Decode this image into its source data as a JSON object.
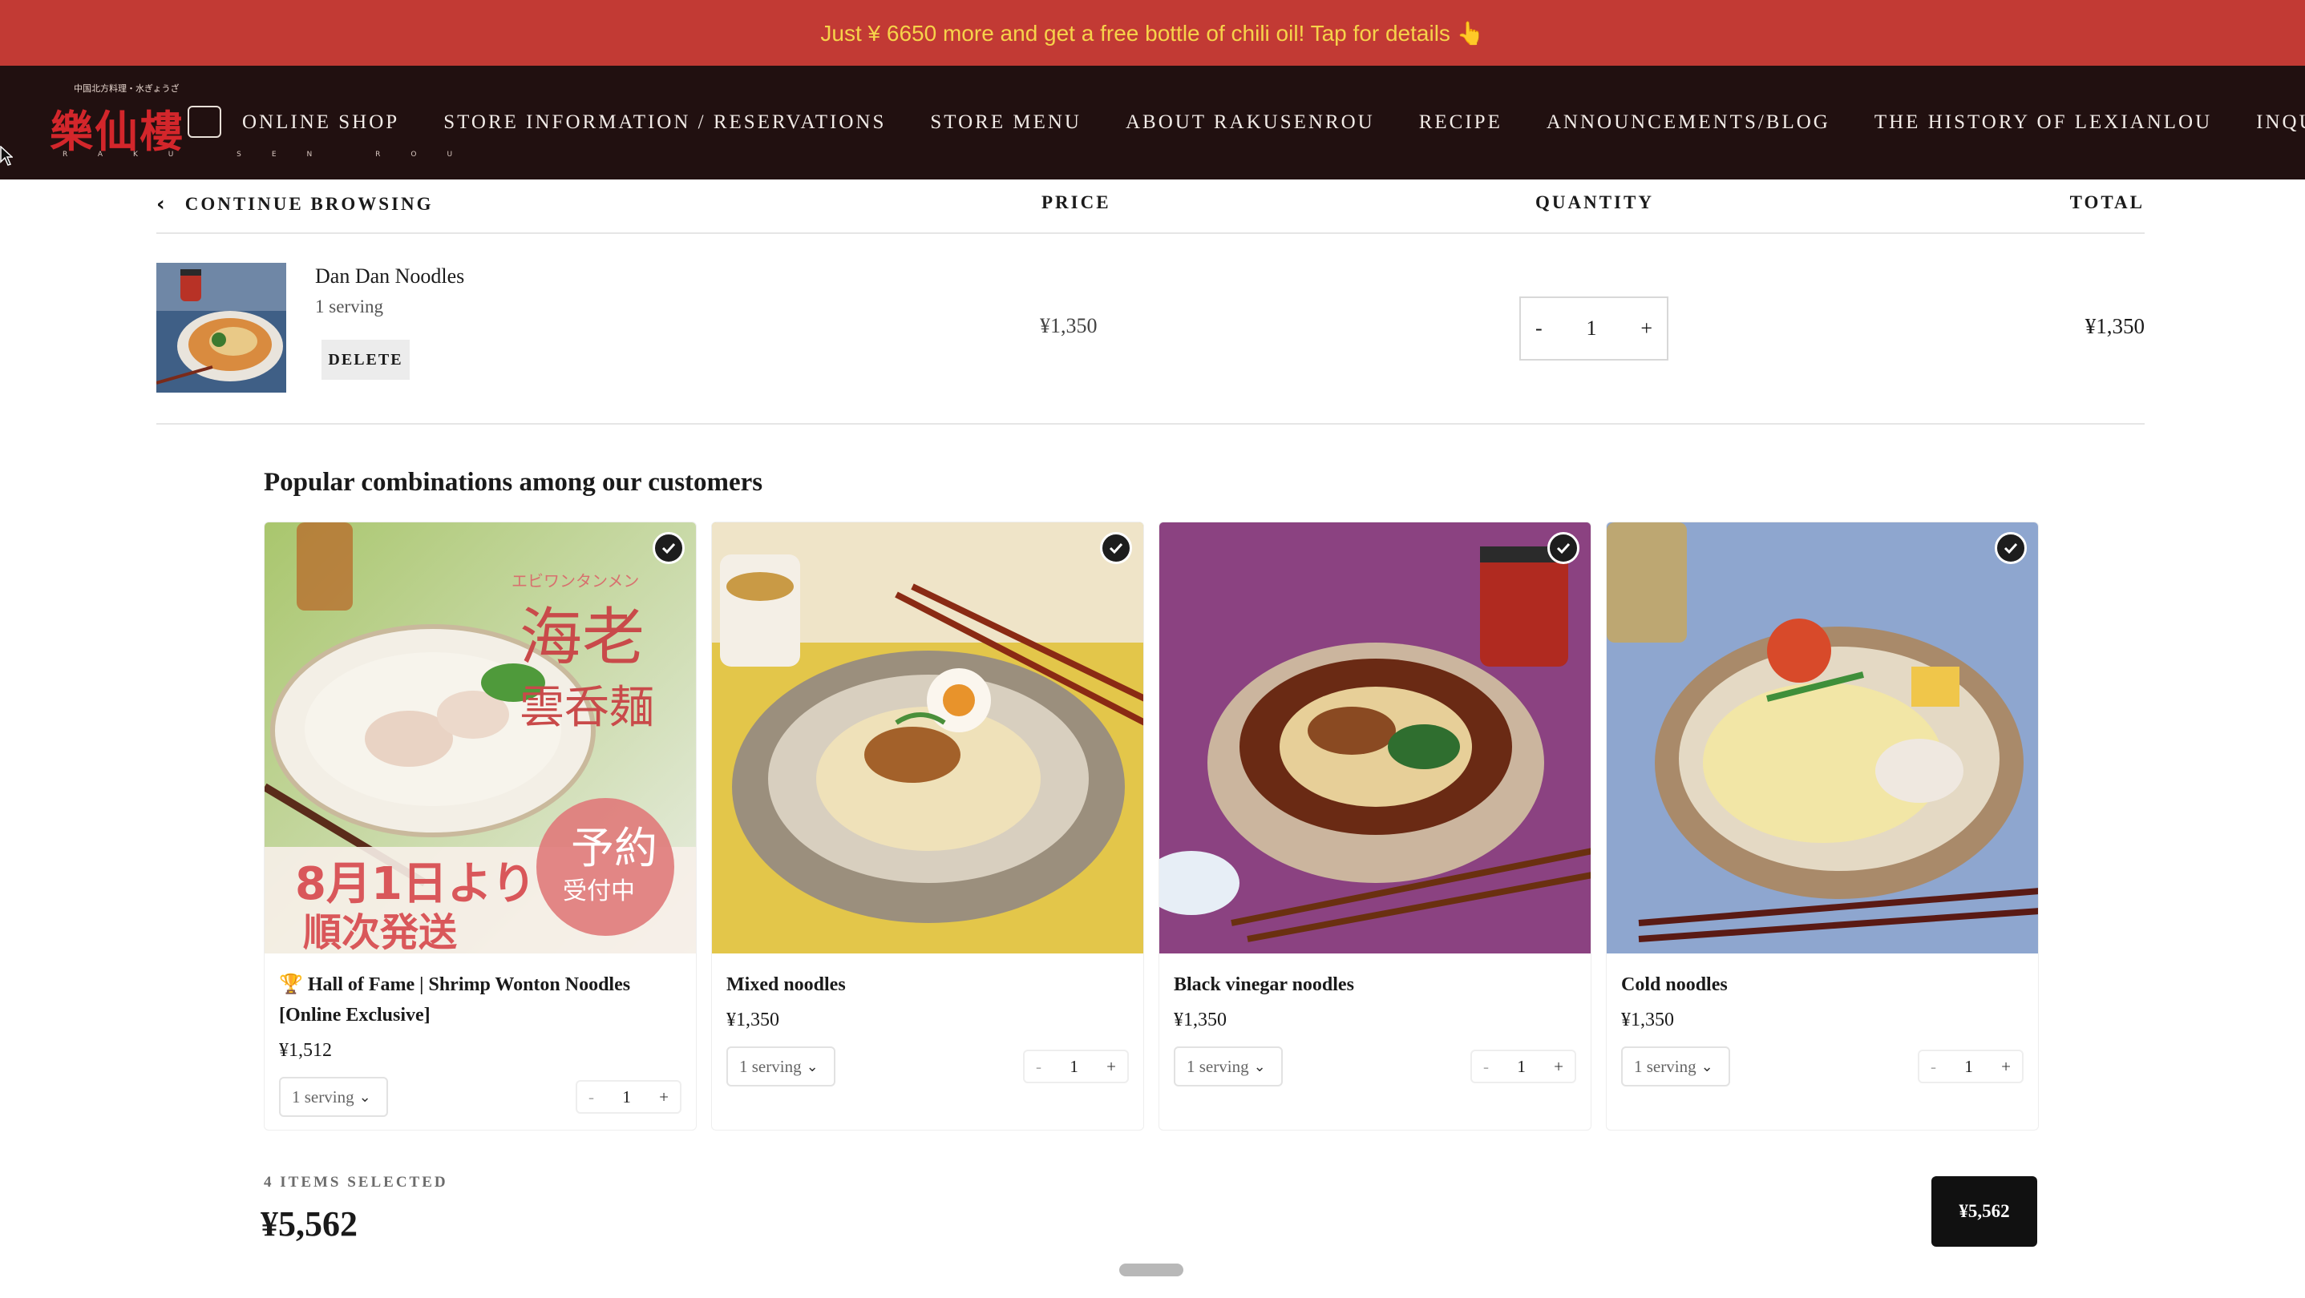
{
  "announcement": {
    "text": "Just ¥ 6650 more and get a free bottle of chili oil! Tap for details 👆"
  },
  "logo": {
    "small_text": "中国北方料理・水ぎょうざ",
    "brand_text": "樂仙樓",
    "sub_text": "RAKU SEN ROU"
  },
  "nav": {
    "items": [
      "ONLINE SHOP",
      "STORE INFORMATION / RESERVATIONS",
      "STORE MENU",
      "ABOUT RAKUSENROU",
      "RECIPE",
      "ANNOUNCEMENTS/BLOG",
      "THE HISTORY OF LEXIANLOU",
      "INQU"
    ]
  },
  "cart": {
    "continue_label": "CONTINUE BROWSING",
    "price_header": "PRICE",
    "quantity_header": "QUANTITY",
    "total_header": "TOTAL",
    "item": {
      "name": "Dan Dan Noodles",
      "variant": "1 serving",
      "delete_label": "DELETE",
      "price": "¥1,350",
      "qty_minus": "-",
      "quantity": "1",
      "qty_plus": "+",
      "total": "¥1,350"
    }
  },
  "combos": {
    "title": "Popular combinations among our customers",
    "cards": [
      {
        "name": "🏆 Hall of Fame | Shrimp Wonton Noodles [Online Exclusive]",
        "price": "¥1,512",
        "serving": "1 serving",
        "qty": "1",
        "minus": "-",
        "plus": "+",
        "img_text": {
          "kana": "エビワンタンメン",
          "title1": "海老",
          "title2": "雲呑麺",
          "date": "8月1日より",
          "ship": "順次発送",
          "badge1": "予約",
          "badge2": "受付中"
        }
      },
      {
        "name": "Mixed noodles",
        "price": "¥1,350",
        "serving": "1 serving",
        "qty": "1",
        "minus": "-",
        "plus": "+"
      },
      {
        "name": "Black vinegar noodles",
        "price": "¥1,350",
        "serving": "1 serving",
        "qty": "1",
        "minus": "-",
        "plus": "+"
      },
      {
        "name": "Cold noodles",
        "price": "¥1,350",
        "serving": "1 serving",
        "qty": "1",
        "minus": "-",
        "plus": "+"
      }
    ]
  },
  "summary": {
    "selected_label": "4 ITEMS SELECTED",
    "total": "¥5,562",
    "button_label": "¥5,562"
  },
  "colors": {
    "announcement_bg": "#c23a34",
    "announcement_text": "#f6d34a",
    "nav_bg": "#211010",
    "button_bg": "#111111"
  }
}
